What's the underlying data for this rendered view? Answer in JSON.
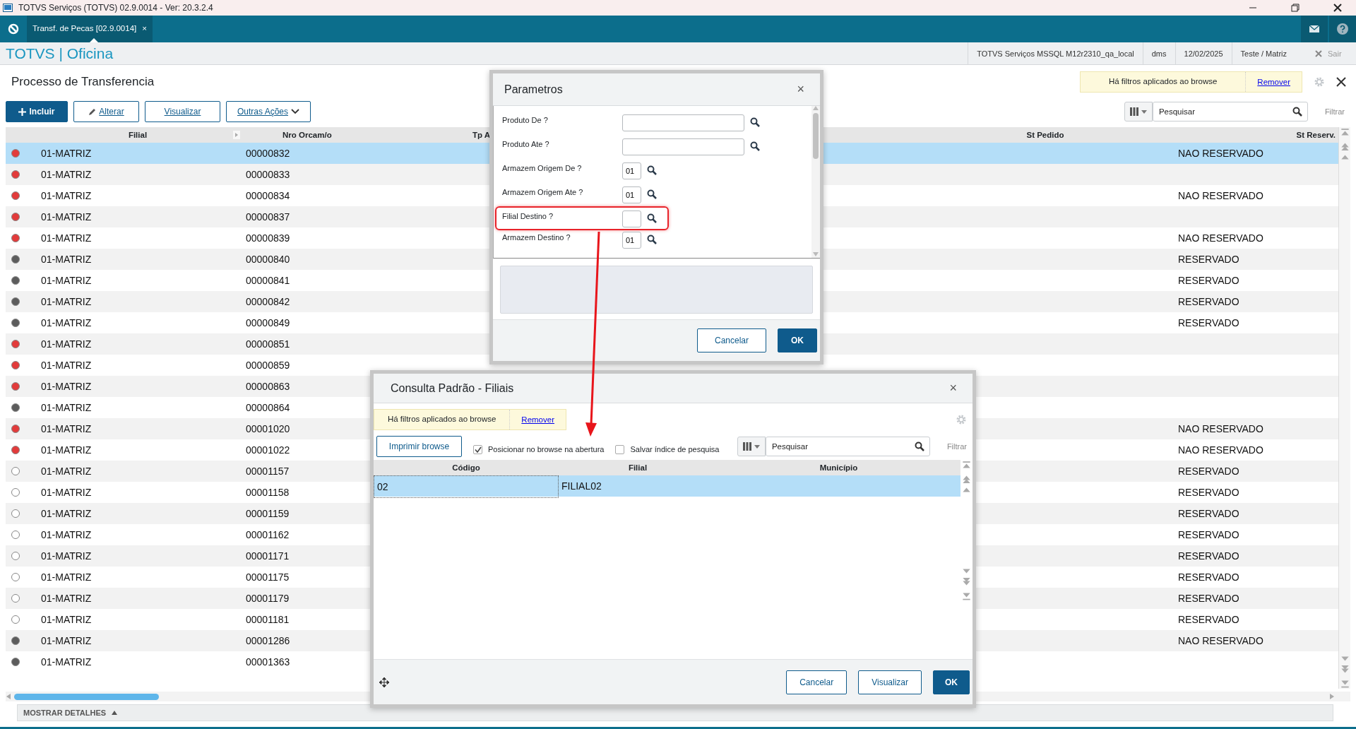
{
  "window": {
    "title": "TOTVS Serviços (TOTVS) 02.9.0014 - Ver: 20.3.2.4"
  },
  "tabs": [
    {
      "label": "Transf. de Pecas [02.9.0014]",
      "close": "×",
      "selected": true
    }
  ],
  "app_header": {
    "brand": "TOTVS | Oficina",
    "info": [
      "TOTVS Serviços MSSQL M12r2310_qa_local",
      "dms",
      "12/02/2025",
      "Teste / Matriz"
    ],
    "logout": "Sair"
  },
  "page": {
    "title": "Processo de Transferencia",
    "actions": [
      {
        "label": "Incluir",
        "kind": "primary"
      },
      {
        "label": "Alterar",
        "kind": "edit"
      },
      {
        "label": "Visualizar",
        "kind": "plain"
      },
      {
        "label": "Outras Ações",
        "kind": "menu"
      }
    ],
    "filter_notice": {
      "text": "Há filtros aplicados ao browse",
      "link": "Remover"
    },
    "search": {
      "placeholder": "Pesquisar"
    },
    "filter_label": "Filtrar"
  },
  "table": {
    "columns": [
      "Filial",
      "Nro Orcam/o",
      "Tp A",
      "St Pedido",
      "St Reserv."
    ],
    "rows": [
      {
        "color": "#e23b3b",
        "filial": "01-MATRIZ",
        "nro": "00000832",
        "st_reserv": "NAO RESERVADO",
        "selected": true
      },
      {
        "color": "#e23b3b",
        "filial": "01-MATRIZ",
        "nro": "00000833",
        "selected": false
      },
      {
        "color": "#e23b3b",
        "filial": "01-MATRIZ",
        "nro": "00000834",
        "st_reserv": "NAO RESERVADO",
        "selected": false
      },
      {
        "color": "#e23b3b",
        "filial": "01-MATRIZ",
        "nro": "00000837",
        "selected": false
      },
      {
        "color": "#e23b3b",
        "filial": "01-MATRIZ",
        "nro": "00000839",
        "st_reserv": "NAO RESERVADO",
        "selected": false
      },
      {
        "color": "#5c5c5c",
        "filial": "01-MATRIZ",
        "nro": "00000840",
        "st_reserv": "RESERVADO",
        "selected": false
      },
      {
        "color": "#5c5c5c",
        "filial": "01-MATRIZ",
        "nro": "00000841",
        "st_reserv": "RESERVADO",
        "selected": false
      },
      {
        "color": "#5c5c5c",
        "filial": "01-MATRIZ",
        "nro": "00000842",
        "st_reserv": "RESERVADO",
        "selected": false
      },
      {
        "color": "#5c5c5c",
        "filial": "01-MATRIZ",
        "nro": "00000849",
        "st_reserv": "RESERVADO",
        "selected": false
      },
      {
        "color": "#e23b3b",
        "filial": "01-MATRIZ",
        "nro": "00000851",
        "selected": false
      },
      {
        "color": "#e23b3b",
        "filial": "01-MATRIZ",
        "nro": "00000859",
        "selected": false
      },
      {
        "color": "#e23b3b",
        "filial": "01-MATRIZ",
        "nro": "00000863",
        "selected": false
      },
      {
        "color": "#5c5c5c",
        "filial": "01-MATRIZ",
        "nro": "00000864",
        "selected": false
      },
      {
        "color": "#e23b3b",
        "filial": "01-MATRIZ",
        "nro": "00001020",
        "st_reserv": "NAO RESERVADO",
        "selected": false
      },
      {
        "color": "#e23b3b",
        "filial": "01-MATRIZ",
        "nro": "00001022",
        "st_reserv": "NAO RESERVADO",
        "selected": false
      },
      {
        "color": "#ffffff",
        "filial": "01-MATRIZ",
        "nro": "00001157",
        "st_reserv": "RESERVADO",
        "selected": false
      },
      {
        "color": "#ffffff",
        "filial": "01-MATRIZ",
        "nro": "00001158",
        "st_reserv": "RESERVADO",
        "selected": false
      },
      {
        "color": "#ffffff",
        "filial": "01-MATRIZ",
        "nro": "00001159",
        "st_reserv": "RESERVADO",
        "selected": false
      },
      {
        "color": "#ffffff",
        "filial": "01-MATRIZ",
        "nro": "00001162",
        "st_reserv": "RESERVADO",
        "selected": false
      },
      {
        "color": "#ffffff",
        "filial": "01-MATRIZ",
        "nro": "00001171",
        "st_reserv": "RESERVADO",
        "selected": false
      },
      {
        "color": "#ffffff",
        "filial": "01-MATRIZ",
        "nro": "00001175",
        "st_reserv": "RESERVADO",
        "selected": false
      },
      {
        "color": "#ffffff",
        "filial": "01-MATRIZ",
        "nro": "00001179",
        "st_reserv": "RESERVADO",
        "selected": false
      },
      {
        "color": "#ffffff",
        "filial": "01-MATRIZ",
        "nro": "00001181",
        "st_reserv": "RESERVADO",
        "selected": false
      },
      {
        "color": "#5c5c5c",
        "filial": "01-MATRIZ",
        "nro": "00001286",
        "st_reserv": "NAO RESERVADO",
        "selected": false
      },
      {
        "color": "#5c5c5c",
        "filial": "01-MATRIZ",
        "nro": "00001363",
        "selected": false
      }
    ]
  },
  "details_toggle": "MOSTRAR DETALHES",
  "parametros": {
    "title": "Parametros",
    "close": "×",
    "params": [
      {
        "label": "Produto De ?",
        "kind": "long",
        "highlighted": false
      },
      {
        "label": "Produto Ate ?",
        "kind": "long",
        "highlighted": false
      },
      {
        "label": "Armazem Origem De ?",
        "kind": "short",
        "value": "01",
        "highlighted": false
      },
      {
        "label": "Armazem Origem Ate ?",
        "kind": "short",
        "value": "01",
        "highlighted": false
      },
      {
        "label": "Filial Destino ?",
        "kind": "short",
        "highlighted": true
      },
      {
        "label": "Armazem Destino ?",
        "kind": "short",
        "value": "01",
        "highlighted": false
      }
    ],
    "buttons": [
      {
        "label": "Cancelar",
        "kind": "outline"
      },
      {
        "label": "OK",
        "kind": "primary"
      }
    ]
  },
  "consulta": {
    "title": "Consulta Padrão - Filiais",
    "close": "×",
    "filter_notice": {
      "text": "Há filtros aplicados ao browse",
      "link": "Remover"
    },
    "print_button": "Imprimir browse",
    "options": [
      {
        "label": "Posicionar no browse na abertura",
        "checked": true
      },
      {
        "label": "Salvar índice de pesquisa",
        "checked": false
      }
    ],
    "search": {
      "placeholder": "Pesquisar"
    },
    "filter_label": "Filtrar",
    "columns": [
      "Código",
      "Filial",
      "Município"
    ],
    "rows": [
      {
        "cells": [
          "02",
          "FILIAL02"
        ],
        "selected": true
      }
    ],
    "buttons": [
      {
        "label": "Cancelar",
        "kind": "outline"
      },
      {
        "label": "Visualizar",
        "kind": "outline"
      },
      {
        "label": "OK",
        "kind": "primary"
      }
    ]
  }
}
